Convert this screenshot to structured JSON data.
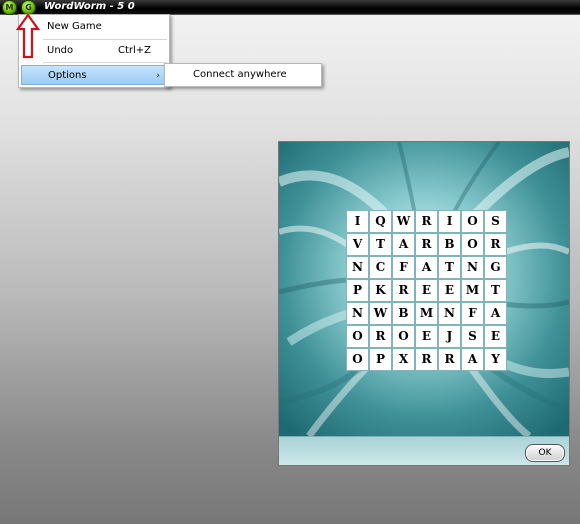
{
  "window": {
    "title": "WordWorm - 5 0",
    "buttons": [
      {
        "icon": "menu-icon",
        "glyph": "M"
      },
      {
        "icon": "back-icon",
        "glyph": "G"
      }
    ]
  },
  "menu": {
    "items": [
      {
        "label": "New Game",
        "shortcut": ""
      },
      {
        "label": "Undo",
        "shortcut": "Ctrl+Z"
      },
      {
        "label": "Options",
        "shortcut": "",
        "submenu": true,
        "highlighted": true
      }
    ],
    "submenu_arrow": "›",
    "submenu": {
      "items": [
        {
          "label": "Connect anywhere"
        }
      ]
    }
  },
  "board": {
    "rows": [
      [
        "I",
        "Q",
        "W",
        "R",
        "I",
        "O",
        "S"
      ],
      [
        "V",
        "T",
        "A",
        "R",
        "B",
        "O",
        "R"
      ],
      [
        "N",
        "C",
        "F",
        "A",
        "T",
        "N",
        "G"
      ],
      [
        "P",
        "K",
        "R",
        "E",
        "E",
        "M",
        "T"
      ],
      [
        "N",
        "W",
        "B",
        "M",
        "N",
        "F",
        "A"
      ],
      [
        "O",
        "R",
        "O",
        "E",
        "J",
        "S",
        "E"
      ],
      [
        "O",
        "P",
        "X",
        "R",
        "R",
        "A",
        "Y"
      ]
    ]
  },
  "dialog": {
    "ok_label": "OK"
  },
  "colors": {
    "annotation_arrow": "#d0101a",
    "menu_highlight": "#9ccbf3",
    "dialog_background": "#5aa7ad"
  }
}
